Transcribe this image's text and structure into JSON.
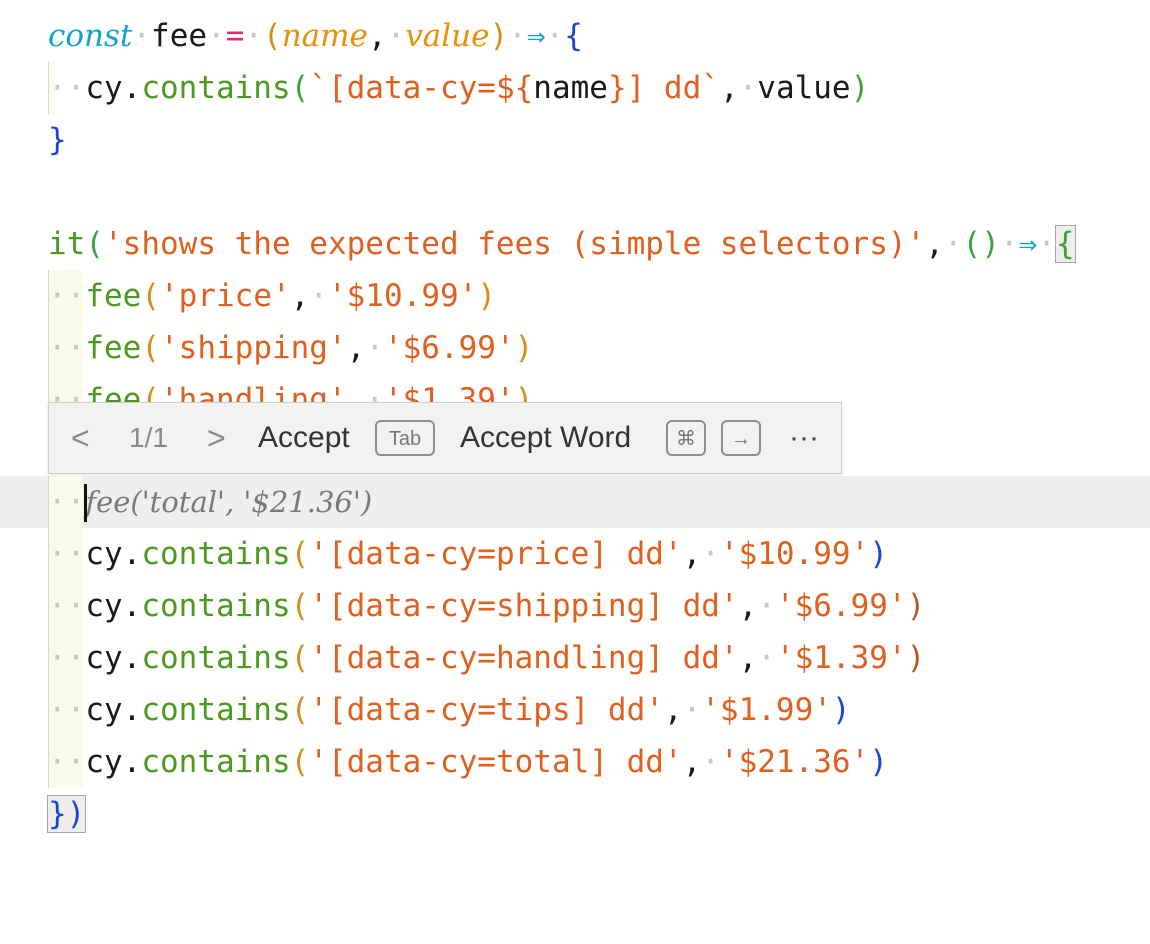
{
  "editor": {
    "fee_def": {
      "kw_const": "const",
      "name": "fee",
      "eq": "=",
      "param_name": "name",
      "comma": ",",
      "param_value": "value",
      "arrow": "⇒",
      "brace_open": "{",
      "brace_close": "}",
      "body_obj": "cy",
      "body_dot": ".",
      "body_fn": "contains",
      "tpl_start": "`[data-cy=",
      "tpl_expr_open": "${",
      "tpl_expr_name": "name",
      "tpl_expr_close": "}",
      "tpl_end": "] dd`",
      "body_value": "value"
    },
    "test": {
      "fn": "it",
      "title": "'shows the expected fees (simple selectors)'",
      "comma": ",",
      "params": "()",
      "arrow": "⇒",
      "brace_open": "{",
      "close": "})"
    },
    "fee_calls": [
      {
        "fn": "fee",
        "arg1": "'price'",
        "arg2": "'$10.99'"
      },
      {
        "fn": "fee",
        "arg1": "'shipping'",
        "arg2": "'$6.99'"
      },
      {
        "fn": "fee",
        "arg1": "'handling'",
        "arg2": "'$1.39'"
      }
    ],
    "ghost_suggestion": "fee('total', '$21.36')",
    "contains_calls": [
      {
        "obj": "cy",
        "fn": "contains",
        "selector": "'[data-cy=price] dd'",
        "value": "'$10.99'"
      },
      {
        "obj": "cy",
        "fn": "contains",
        "selector": "'[data-cy=shipping] dd'",
        "value": "'$6.99'"
      },
      {
        "obj": "cy",
        "fn": "contains",
        "selector": "'[data-cy=handling] dd'",
        "value": "'$1.39'"
      },
      {
        "obj": "cy",
        "fn": "contains",
        "selector": "'[data-cy=tips] dd'",
        "value": "'$1.99'"
      },
      {
        "obj": "cy",
        "fn": "contains",
        "selector": "'[data-cy=total] dd'",
        "value": "'$21.36'"
      }
    ]
  },
  "suggestion_toolbar": {
    "prev_icon": "<",
    "counter": "1/1",
    "next_icon": ">",
    "accept_label": "Accept",
    "accept_key": "Tab",
    "accept_word_label": "Accept Word",
    "accept_word_key_mod": "⌘",
    "accept_word_key_arrow": "→",
    "more_icon": "···"
  },
  "colors": {
    "keyword": "#12a3cf",
    "function": "#4c9a1f",
    "string": "#e0601f",
    "parameter": "#e6930a",
    "ghost_text": "#7a7a7a",
    "toolbar_bg": "#f2f2f2"
  }
}
